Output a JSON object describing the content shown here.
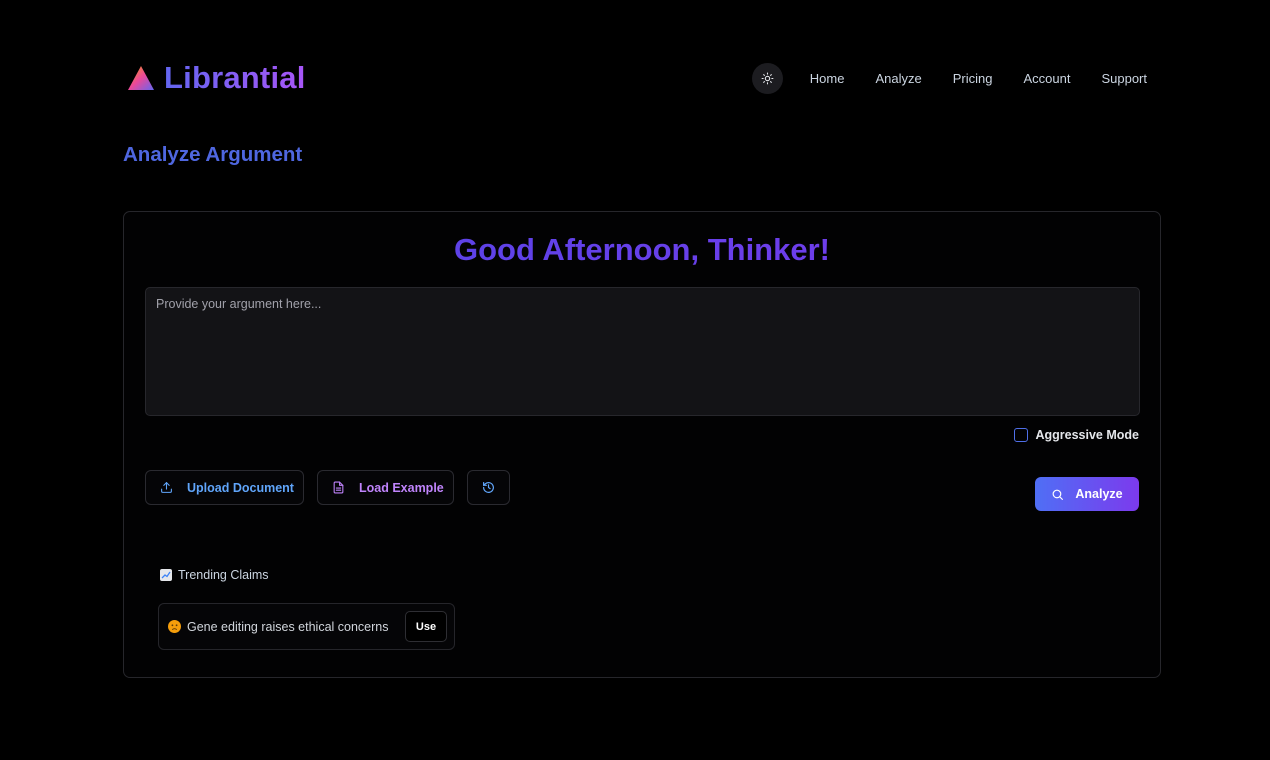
{
  "app": {
    "name": "Librantial"
  },
  "nav": {
    "items": [
      {
        "label": "Home"
      },
      {
        "label": "Analyze"
      },
      {
        "label": "Pricing"
      },
      {
        "label": "Account"
      },
      {
        "label": "Support"
      }
    ],
    "theme_icon": "sun-icon"
  },
  "page": {
    "title": "Analyze Argument"
  },
  "card": {
    "greeting": "Good Afternoon, Thinker!",
    "argument_input": {
      "placeholder": "Provide your argument here...",
      "value": ""
    },
    "aggressive_mode": {
      "label": "Aggressive Mode",
      "checked": false
    },
    "buttons": {
      "upload": {
        "label": "Upload Document",
        "icon": "upload-icon"
      },
      "example": {
        "label": "Load Example",
        "icon": "file-text-icon"
      },
      "history": {
        "icon": "history-icon"
      },
      "analyze": {
        "label": "Analyze",
        "icon": "search-icon"
      }
    },
    "trending": {
      "heading": "Trending Claims",
      "icon": "chart-increasing-icon",
      "items": [
        {
          "text": "Gene editing raises ethical concerns",
          "icon": "worried-face-emoji",
          "action": "Use"
        }
      ]
    }
  },
  "colors": {
    "background": "#000000",
    "accent_blue": "#4f67e0",
    "accent_purple": "#7c3aed",
    "upload_text": "#60a5fa",
    "example_text": "#c084fc"
  }
}
